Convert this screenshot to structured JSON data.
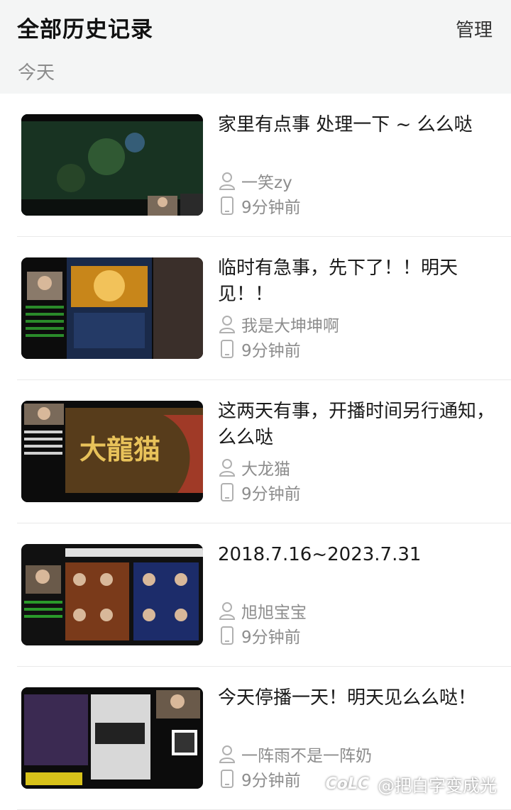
{
  "header": {
    "title": "全部历史记录",
    "manage_label": "管理",
    "section_label": "今天"
  },
  "items": [
    {
      "title": "家里有点事 处理一下 ~ 么么哒",
      "streamer": "一笑zy",
      "time": "9分钟前",
      "thumb_colors": [
        "#0f2418",
        "#3a5a2a",
        "#1e3b4a"
      ]
    },
    {
      "title": "临时有急事，先下了！！明天见！！",
      "streamer": "我是大坤坤啊",
      "time": "9分钟前",
      "thumb_colors": [
        "#0c0c0c",
        "#c8861a",
        "#2a3f6b"
      ]
    },
    {
      "title": "这两天有事，开播时间另行通知，么么哒",
      "streamer": "大龙猫",
      "time": "9分钟前",
      "thumb_colors": [
        "#0c0c0c",
        "#6b4a1e",
        "#b33a2a"
      ],
      "thumb_overlay_text": "大龍猫"
    },
    {
      "title": "2018.7.16~2023.7.31",
      "streamer": "旭旭宝宝",
      "time": "9分钟前",
      "thumb_colors": [
        "#111111",
        "#d9a64a",
        "#2c3e8a"
      ]
    },
    {
      "title": "今天停播一天！明天见么么哒！",
      "streamer": "一阵雨不是一阵奶",
      "time": "9分钟前",
      "thumb_colors": [
        "#0c0c0c",
        "#3b2a52",
        "#d8d8d8"
      ]
    }
  ],
  "watermark": {
    "logo": "CoLC",
    "text": "@把白字变成光"
  },
  "icons": {
    "user": "user-icon",
    "device": "phone-icon"
  }
}
